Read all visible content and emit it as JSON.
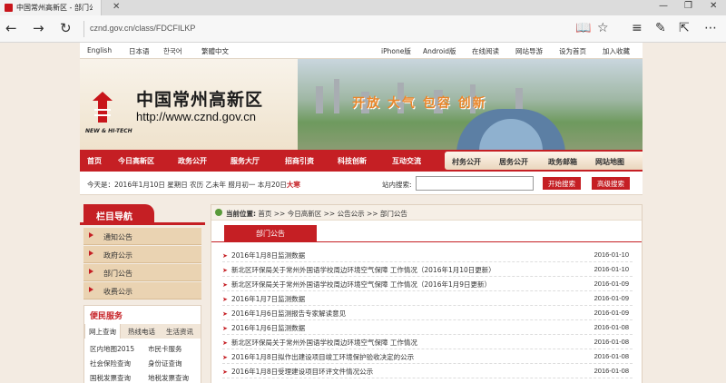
{
  "browser": {
    "tab_title": "中国常州高新区 - 部门公",
    "tab_close": "✕",
    "url": "cznd.gov.cn/class/FDCFILKP",
    "win_minimize": "—",
    "win_restore": "❐",
    "win_close": "✕"
  },
  "toplinks": {
    "left": [
      "English",
      "日本语",
      "한국어",
      "繁體中文"
    ],
    "right": [
      "iPhone版",
      "Android版",
      "在线阅读",
      "网站导游",
      "设为首页",
      "加入收藏"
    ]
  },
  "banner": {
    "logo_sub": "NEW & HI-TECH",
    "site_name": "中国常州高新区",
    "site_url": "http://www.cznd.gov.cn",
    "slogan": "开放 大气 包容 创新"
  },
  "mainnav": [
    "首页",
    "今日高新区",
    "政务公开",
    "服务大厅",
    "招商引资",
    "科技创新",
    "互动交流"
  ],
  "subnav": [
    "村务公开",
    "居务公开",
    "政务邮箱",
    "网站地图"
  ],
  "infobar": {
    "today_prefix": "今天是：2016年1月10日 星期日 农历 乙未年 腊月初一 本月20日",
    "today_highlight": "大寒",
    "search_label": "站内搜索:",
    "search_value": "",
    "search_button": "开始搜索",
    "advanced_button": "高级搜索"
  },
  "sidebar": {
    "title": "栏目导航",
    "items": [
      "通知公告",
      "政府公示",
      "部门公告",
      "收费公示"
    ]
  },
  "minsvc": {
    "title": "便民服务",
    "tabs": [
      "网上查询",
      "热线电话",
      "生活资讯"
    ],
    "links": [
      "区内地图2015",
      "市民卡服务",
      "社会保险查询",
      "身份证查询",
      "国税发票查询",
      "地税发票查询"
    ]
  },
  "content": {
    "breadcrumb_label": "当前位置:",
    "breadcrumb": "首页 >> 今日高新区 >> 公告公示 >> 部门公告",
    "section_title": "部门公告",
    "rows": [
      {
        "title": "2016年1月8日监测数据",
        "date": "2016-01-10"
      },
      {
        "title": "新北区环保局关于常州外国语学校周边环境空气保障 工作情况（2016年1月10日更新）",
        "date": "2016-01-10"
      },
      {
        "title": "新北区环保局关于常州外国语学校周边环境空气保障 工作情况（2016年1月9日更新）",
        "date": "2016-01-09"
      },
      {
        "title": "2016年1月7日监测数据",
        "date": "2016-01-09"
      },
      {
        "title": "2016年1月6日监测报告专家解读意见",
        "date": "2016-01-09"
      },
      {
        "title": "2016年1月6日监测数据",
        "date": "2016-01-08"
      },
      {
        "title": "新北区环保局关于常州外国语学校周边环境空气保障 工作情况",
        "date": "2016-01-08"
      },
      {
        "title": "2016年1月8日拟作出建设项目竣工环境保护验收决定的公示",
        "date": "2016-01-08"
      },
      {
        "title": "2016年1月8日受理建设项目环评文件情况公示",
        "date": "2016-01-08"
      }
    ]
  }
}
